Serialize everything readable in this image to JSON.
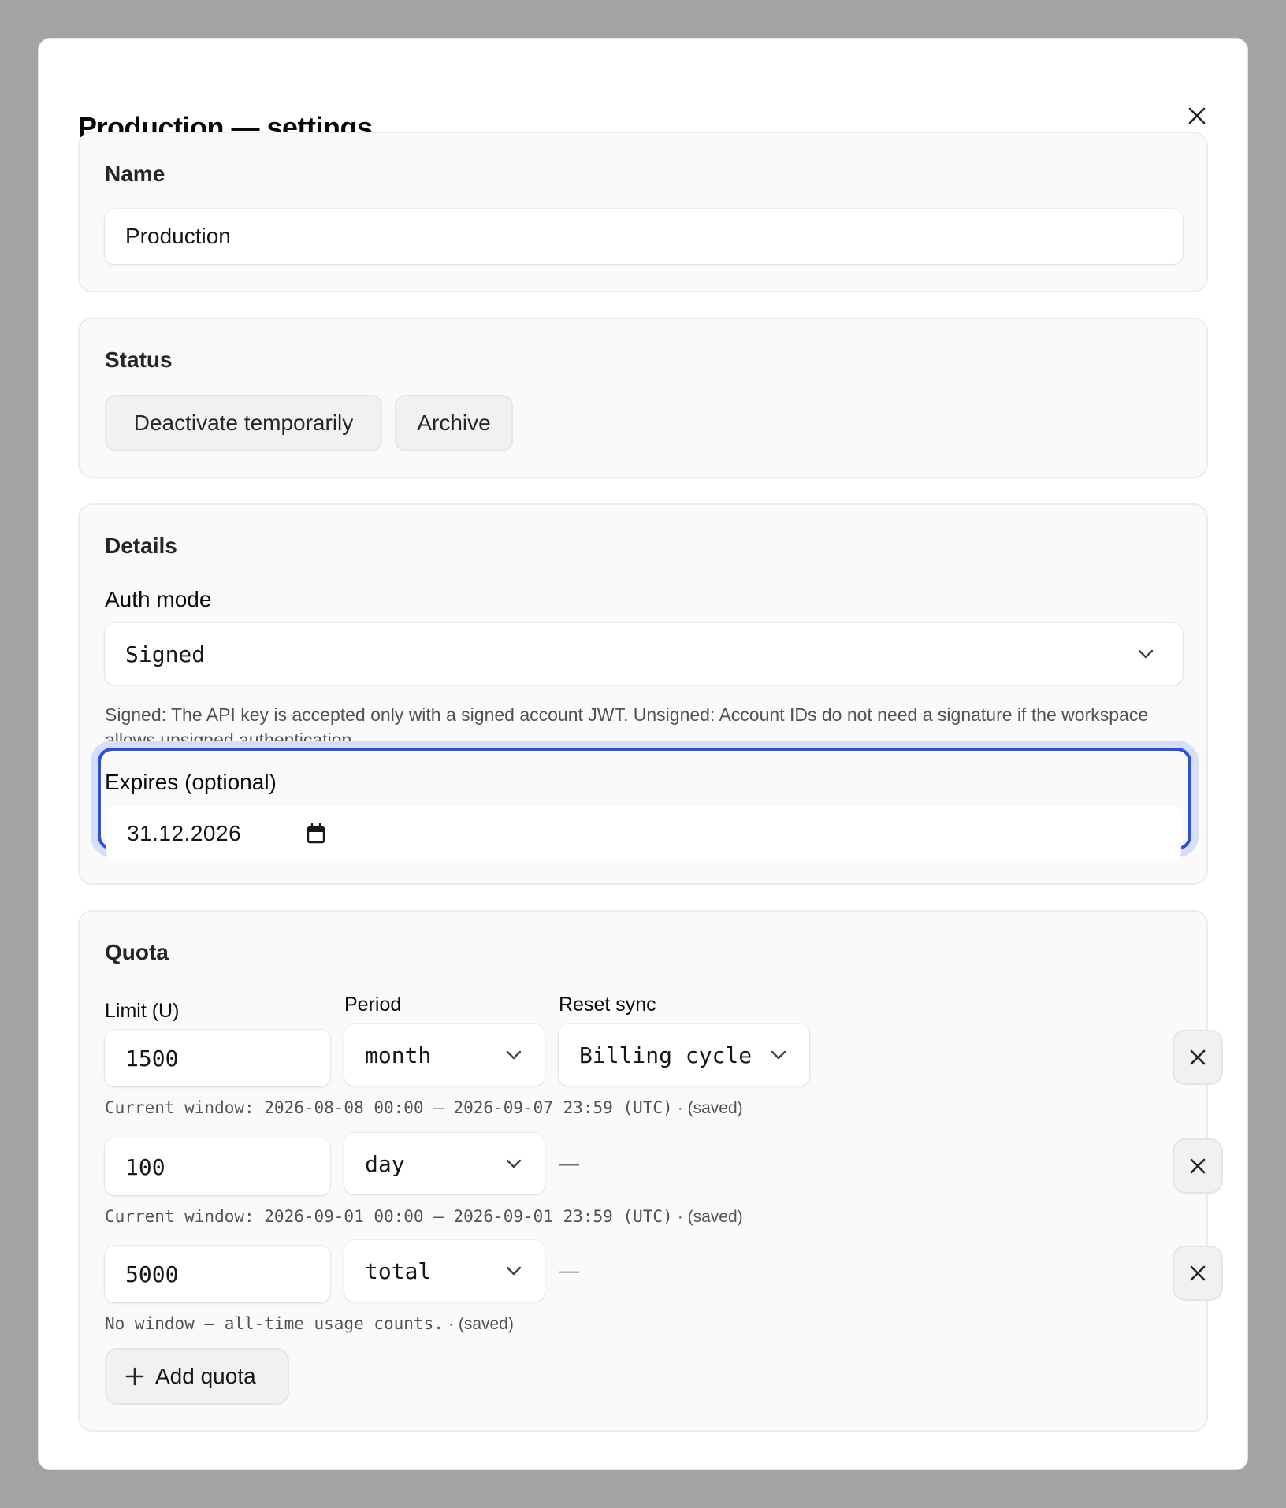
{
  "dialog": {
    "title": "Production — settings",
    "close_icon": "close-icon"
  },
  "name_section": {
    "title": "Name",
    "value": "Production"
  },
  "status_section": {
    "title": "Status",
    "deactivate_label": "Deactivate temporarily",
    "archive_label": "Archive"
  },
  "details_section": {
    "title": "Details",
    "auth_mode_label": "Auth mode",
    "auth_mode_value": "Signed",
    "auth_mode_help": "Signed: The API key is accepted only with a signed account JWT. Unsigned: Account IDs do not need a signature if the workspace allows unsigned authentication.",
    "expires_label": "Expires (optional)",
    "expires_value": "31.12.2026",
    "expires_icon": "calendar-icon"
  },
  "quota_section": {
    "title": "Quota",
    "headers": {
      "limit": "Limit (U)",
      "period": "Period",
      "reset_sync": "Reset sync"
    },
    "rows": [
      {
        "limit": "1500",
        "period": "month",
        "reset_sync": "Billing cycle",
        "window": "Current window: 2026-08-08 00:00 – 2026-09-07 23:59 (UTC)",
        "saved": "· (saved)"
      },
      {
        "limit": "100",
        "period": "day",
        "reset_sync": "—",
        "window": "Current window: 2026-09-01 00:00 – 2026-09-01 23:59 (UTC)",
        "saved": "· (saved)"
      },
      {
        "limit": "5000",
        "period": "total",
        "reset_sync": "—",
        "window": "No window — all-time usage counts.",
        "saved": "· (saved)"
      }
    ],
    "add_label": "Add quota"
  },
  "colors": {
    "overlay": "#a3a3a3",
    "focus_ring": "#2b50e8",
    "section_bg": "#fafafa"
  }
}
